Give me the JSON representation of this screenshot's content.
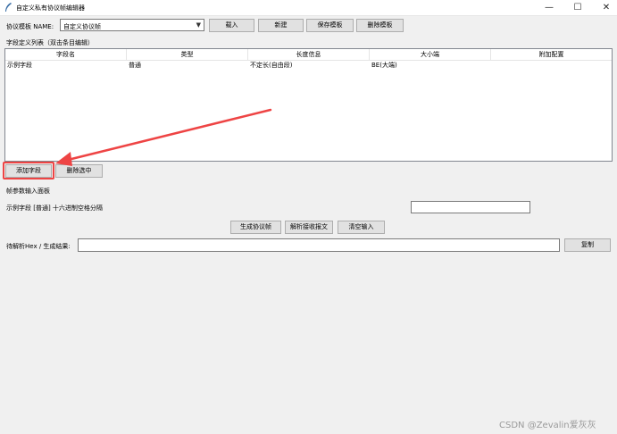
{
  "window": {
    "title": "自定义私有协议帧编辑器",
    "min_glyph": "—",
    "max_glyph": "☐",
    "close_glyph": "✕"
  },
  "template_row": {
    "label": "协议模板 NAME:",
    "selected": "自定义协议帧",
    "load_label": "载入",
    "new_label": "新建",
    "save_label": "保存模板",
    "delete_label": "删除模板"
  },
  "field_list": {
    "heading": "字段定义列表（双击条目编辑）",
    "columns": [
      "字段名",
      "类型",
      "长度信息",
      "大小端",
      "附加配置"
    ],
    "rows": [
      [
        "示例字段",
        "普通",
        "不定长(自由段)",
        "BE(大端)",
        ""
      ]
    ]
  },
  "field_actions": {
    "add_label": "添加字段",
    "delete_label": "删除选中"
  },
  "params": {
    "heading": "帧参数输入面板",
    "field_label": "示例字段 [普通]  十六进制空格分隔",
    "field_value": ""
  },
  "actions": {
    "generate_label": "生成协议帧",
    "parse_label": "解析接收报文",
    "clear_label": "清空输入"
  },
  "hex": {
    "label": "待解析Hex / 生成结果:",
    "value": "",
    "copy_label": "复制"
  },
  "annotation": {
    "color": "#ee4444"
  },
  "watermark": "CSDN @Zevalin爱灰灰"
}
